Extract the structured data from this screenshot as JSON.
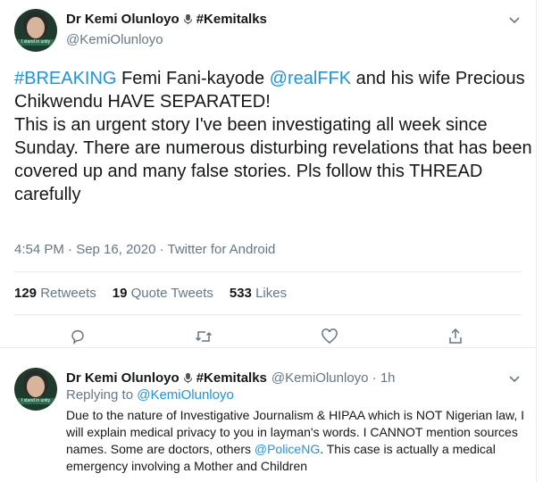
{
  "tweet": {
    "display_name": "Dr Kemi Olunloyo",
    "hashtag_name": "#Kemitalks",
    "handle": "@KemiOlunloyo",
    "avatar_caption": "I stand in unity",
    "text_parts": [
      {
        "t": "#BREAKING",
        "link": true
      },
      {
        "t": " Femi Fani-kayode ",
        "link": false
      },
      {
        "t": "@realFFK",
        "link": true
      },
      {
        "t": " and his wife Precious Chikwendu HAVE SEPARATED!\nThis is an urgent story I've been investigating all week since Sunday. There are numerous disturbing revelations that has been covered up and many false stories. Pls follow this THREAD carefully",
        "link": false
      }
    ],
    "timestamp": "4:54 PM · Sep 16, 2020 · Twitter for Android",
    "retweets_count": "129",
    "retweets_label": "Retweets",
    "quotes_count": "19",
    "quotes_label": "Quote Tweets",
    "likes_count": "533",
    "likes_label": "Likes",
    "icons": [
      "reply-icon",
      "retweet-icon",
      "like-icon",
      "share-icon",
      "caret-down-icon",
      "microphone-icon"
    ]
  },
  "reply": {
    "display_name": "Dr Kemi Olunloyo",
    "hashtag_name": "#Kemitalks",
    "handle_time": "@KemiOlunloyo · 1h",
    "replying_prefix": "Replying to",
    "replying_to": "@KemiOlunloyo",
    "text_before": "Due to the nature of Investigative Journalism & HIPAA which is NOT Nigerian law, I will explain medical privacy to you in layman's words. I CANNOT mention sources names. Some are doctors, others ",
    "text_link": "@PoliceNG",
    "text_after": ". This case is actually a medical emergency involving a Mother and Children"
  },
  "colors": {
    "link": "#1b95e0",
    "muted": "#657786",
    "text": "#14171a",
    "border": "#e6ecf0"
  }
}
